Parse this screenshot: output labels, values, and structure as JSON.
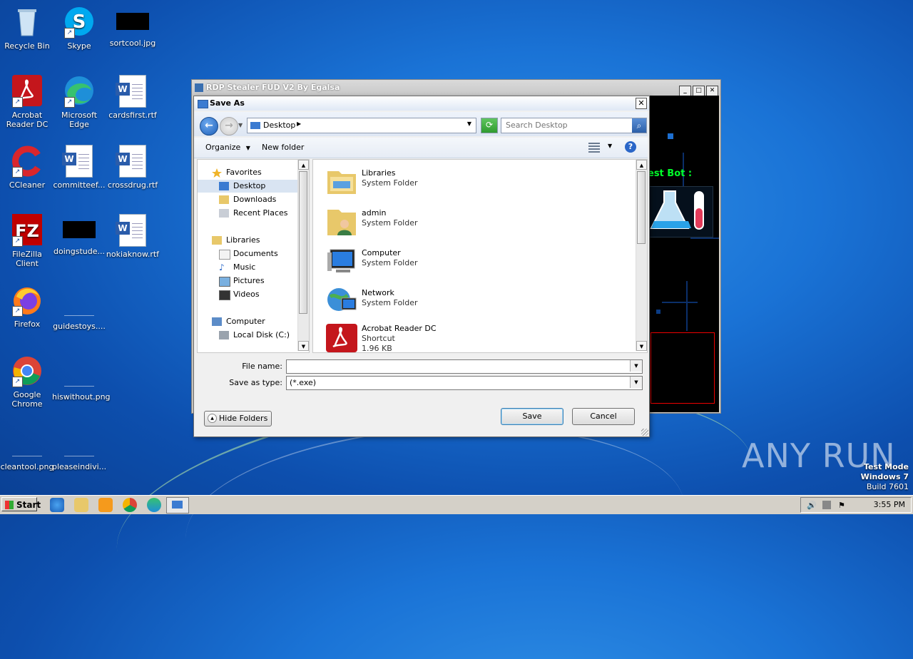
{
  "desktop": {
    "icons": [
      {
        "label": "Recycle Bin"
      },
      {
        "label": "Skype"
      },
      {
        "label": "sortcool.jpg"
      },
      {
        "label": "Acrobat Reader DC"
      },
      {
        "label": "Microsoft Edge"
      },
      {
        "label": "cardsfirst.rtf"
      },
      {
        "label": "CCleaner"
      },
      {
        "label": "committeef..."
      },
      {
        "label": "crossdrug.rtf"
      },
      {
        "label": "FileZilla Client"
      },
      {
        "label": "doingstude..."
      },
      {
        "label": "nokiaknow.rtf"
      },
      {
        "label": "Firefox"
      },
      {
        "label": "guidestoys...."
      },
      {
        "label": "Google Chrome"
      },
      {
        "label": "hiswithout.png"
      },
      {
        "label": "cleantool.png"
      },
      {
        "label": "pleaseindivi..."
      }
    ]
  },
  "bg_window": {
    "title": "RDP Stealer FUD V2 By Egalsa",
    "bot_text": "est Bot :"
  },
  "dialog": {
    "title": "Save As",
    "address": "Desktop",
    "search_placeholder": "Search Desktop",
    "toolbar": {
      "organize": "Organize",
      "new_folder": "New folder"
    },
    "nav": [
      {
        "label": "Favorites"
      },
      {
        "label": "Desktop"
      },
      {
        "label": "Downloads"
      },
      {
        "label": "Recent Places"
      },
      {
        "label": "Libraries"
      },
      {
        "label": "Documents"
      },
      {
        "label": "Music"
      },
      {
        "label": "Pictures"
      },
      {
        "label": "Videos"
      },
      {
        "label": "Computer"
      },
      {
        "label": "Local Disk (C:)"
      }
    ],
    "items": [
      {
        "name": "Libraries",
        "type": "System Folder"
      },
      {
        "name": "admin",
        "type": "System Folder"
      },
      {
        "name": "Computer",
        "type": "System Folder"
      },
      {
        "name": "Network",
        "type": "System Folder"
      },
      {
        "name": "Acrobat Reader DC",
        "type": "Shortcut",
        "size": "1.96 KB"
      }
    ],
    "file_name_label": "File name:",
    "file_name_value": "",
    "save_type_label": "Save as type:",
    "save_type_value": "(*.exe)",
    "hide_folders": "Hide Folders",
    "save": "Save",
    "cancel": "Cancel"
  },
  "watermark": {
    "text": "ANY RUN",
    "mode": "Test Mode",
    "os": "Windows 7",
    "build": "Build 7601"
  },
  "taskbar": {
    "start": "Start",
    "clock": "3:55 PM"
  }
}
